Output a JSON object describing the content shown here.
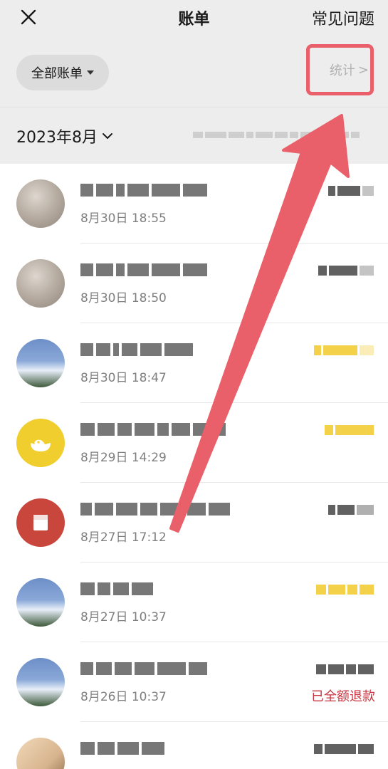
{
  "nav": {
    "title": "账单",
    "faq_label": "常见问题",
    "close_icon": "close-icon"
  },
  "filter": {
    "all_bills_label": "全部账单",
    "stats_label": "统计",
    "stats_chevron": ">"
  },
  "month": {
    "label": "2023年8月",
    "chevron_icon": "chevron-down-icon"
  },
  "transactions": [
    {
      "time": "8月30日 18:55",
      "avatar": "photo-cat"
    },
    {
      "time": "8月30日 18:50",
      "avatar": "photo-cat"
    },
    {
      "time": "8月30日 18:47",
      "avatar": "photo-sky"
    },
    {
      "time": "8月29日 14:29",
      "avatar": "yellow-duck"
    },
    {
      "time": "8月27日 17:12",
      "avatar": "red-envelope"
    },
    {
      "time": "8月27日 10:37",
      "avatar": "photo-sky"
    },
    {
      "time": "8月26日 10:37",
      "avatar": "photo-sky",
      "status": "已全额退款"
    },
    {
      "time": "",
      "avatar": "photo-person"
    }
  ],
  "colors": {
    "header_bg": "#ededed",
    "highlight_red": "#e9606a",
    "refund_red": "#c9333f",
    "amount_yellow": "#f3d24a"
  }
}
